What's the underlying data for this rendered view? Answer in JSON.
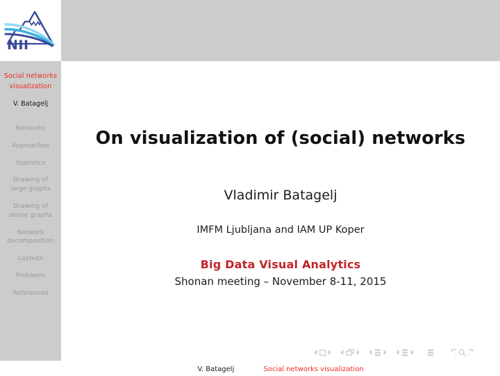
{
  "slide": {
    "logo": {
      "name": "nii-logo",
      "wordmark": "NII",
      "mark_color": "#3b4a99",
      "wave_color": "#2bb3e8"
    },
    "colors": {
      "sidebar_bg": "#cccccc",
      "header_bg": "#cccccc",
      "accent_red": "#ee2b22",
      "event_red": "#c0242a",
      "sidebar_item": "#9a9a9a",
      "page_bg": "#ffffff"
    },
    "sidebar": {
      "title_lines": [
        "Social",
        "networks",
        "visualization"
      ],
      "author": "V. Batagelj",
      "items": [
        {
          "lines": [
            "Networks"
          ]
        },
        {
          "lines": [
            "Approaches"
          ]
        },
        {
          "lines": [
            "Statistics"
          ]
        },
        {
          "lines": [
            "Drawing of",
            "large graphs"
          ]
        },
        {
          "lines": [
            "Drawing of",
            "dense graphs"
          ]
        },
        {
          "lines": [
            "Network",
            "decomposition"
          ]
        },
        {
          "lines": [
            "Layouts"
          ]
        },
        {
          "lines": [
            "Problems"
          ]
        },
        {
          "lines": [
            "References"
          ]
        }
      ]
    },
    "main": {
      "title": "On visualization of (social) networks",
      "author": "Vladimir Batagelj",
      "affiliation": "IMFM Ljubljana and IAM UP Koper",
      "event_title": "Big Data Visual Analytics",
      "event_subtitle": "Shonan meeting – November 8-11, 2015"
    },
    "navigation": {
      "symbols": [
        {
          "name": "slide-navigation",
          "icon": "square"
        },
        {
          "name": "frame-navigation",
          "icon": "frames"
        },
        {
          "name": "subsection-navigation",
          "icon": "subsection"
        },
        {
          "name": "section-navigation",
          "icon": "section"
        },
        {
          "name": "presentation-navigation",
          "icon": "presentation"
        },
        {
          "name": "back-navigation",
          "icon": "undo-arrow"
        },
        {
          "name": "find-navigation",
          "icon": "magnifier"
        },
        {
          "name": "forward-navigation",
          "icon": "redo-arrow"
        }
      ]
    },
    "footer": {
      "author": "V. Batagelj",
      "title": "Social networks visualization"
    }
  }
}
